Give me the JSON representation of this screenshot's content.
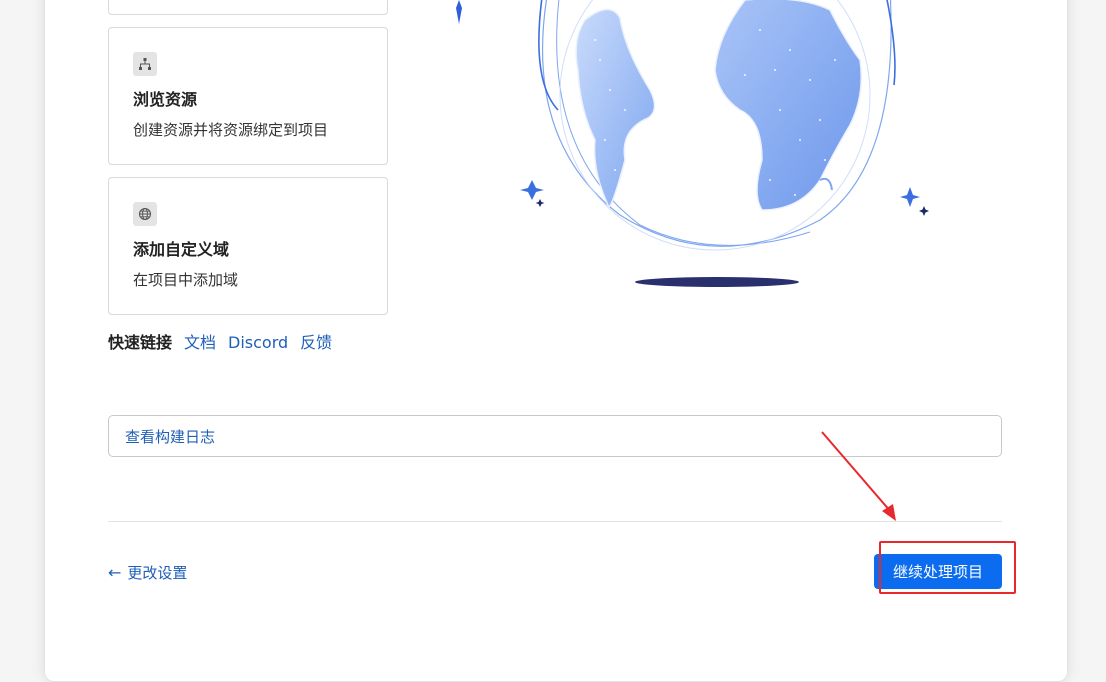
{
  "cards": [
    {
      "title": "浏览资源",
      "description": "创建资源并将资源绑定到项目",
      "icon": "sitemap-icon"
    },
    {
      "title": "添加自定义域",
      "description": "在项目中添加域",
      "icon": "globe-icon"
    }
  ],
  "quick_links": {
    "label": "快速链接",
    "links": [
      "文档",
      "Discord",
      "反馈"
    ]
  },
  "build_log_button": "查看构建日志",
  "back_link": "更改设置",
  "continue_button": "继续处理项目",
  "colors": {
    "accent": "#0b6cf0",
    "link": "#1f5fb8",
    "highlight": "#e8282c",
    "globe": "#7ea6f0"
  }
}
